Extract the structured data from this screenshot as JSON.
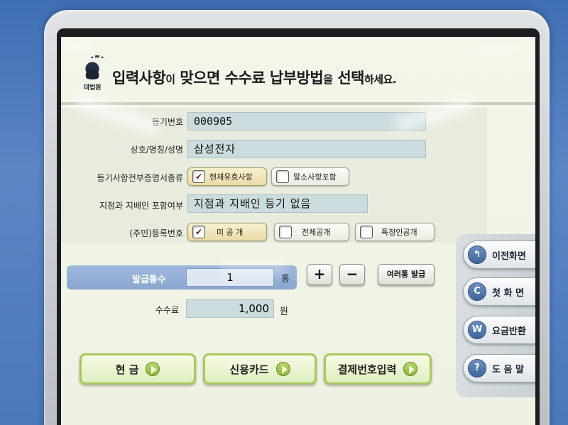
{
  "header": {
    "org_label": "대법원",
    "title_part1": "입력사항",
    "title_conj1": "이",
    "title_part2": " 맞으면 수수료 납부방법",
    "title_conj2": "을",
    "title_part3": " 선택",
    "title_end": "하세요."
  },
  "form": {
    "reg_no_label": "등기번호",
    "reg_no_value": "000905",
    "name_label": "상호/명칭/성명",
    "name_value": "삼성전자",
    "cert_type_label": "등기사항전부증명서종류",
    "cert_options": [
      {
        "label": "현재유효사항",
        "checked": true
      },
      {
        "label": "말소사항포함",
        "checked": false
      }
    ],
    "branch_label": "지점과 지배인 포함여부",
    "branch_value": "지점과 지배인 등기 없음",
    "id_no_label": "(주민)등록번호",
    "id_options": [
      {
        "label": "미 공 개",
        "checked": true
      },
      {
        "label": "전체공개",
        "checked": false
      },
      {
        "label": "특정인공개",
        "checked": false
      }
    ]
  },
  "quantity": {
    "label": "발급통수",
    "value": "1",
    "unit": "통",
    "plus": "+",
    "minus": "−",
    "multi_button": "여러통 발급"
  },
  "fee": {
    "label": "수수료",
    "value": "1,000",
    "unit": "원"
  },
  "payment": {
    "cash": "현 금",
    "card": "신용카드",
    "code": "결제번호입력"
  },
  "side": {
    "prev": "이전화면",
    "home": "첫 화 면",
    "refund": "요금반환",
    "help": "도 움 말",
    "prev_icon": "↰",
    "home_icon": "C",
    "refund_icon": "W",
    "help_icon": "?"
  },
  "colors": {
    "accent_green": "#a7c85c",
    "field_blue": "#cbdcdf",
    "qty_band": "#8aa7d1"
  }
}
